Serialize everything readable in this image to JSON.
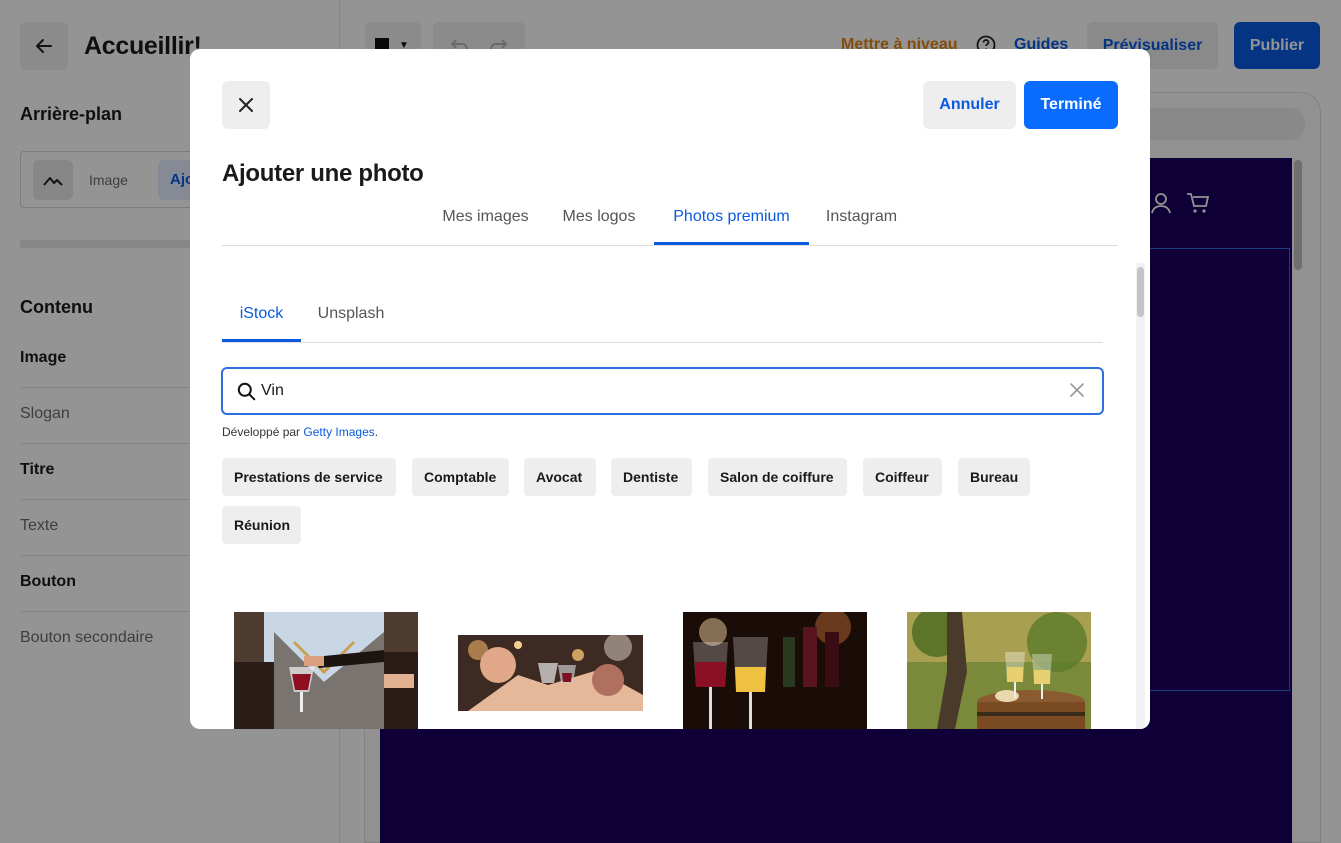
{
  "editor": {
    "page_title": "Accueillir!",
    "background_section": "Arrière-plan",
    "background_image_label": "Image",
    "background_add_label": "Ajouter",
    "content_section": "Contenu",
    "content_items": [
      "Image",
      "Slogan",
      "Titre",
      "Texte",
      "Bouton",
      "Bouton secondaire"
    ],
    "upgrade": "Mettre à niveau",
    "guides": "Guides",
    "preview": "Prévisualiser",
    "publish": "Publier",
    "site_color": "#1a0060",
    "accent_color": "#0a5be0",
    "upgrade_color": "#e0851a"
  },
  "modal": {
    "title": "Ajouter une photo",
    "cancel": "Annuler",
    "done": "Terminé",
    "tabs": [
      "Mes images",
      "Mes logos",
      "Photos premium",
      "Instagram"
    ],
    "active_tab": "Photos premium",
    "sub_tabs": [
      "iStock",
      "Unsplash"
    ],
    "active_sub_tab": "iStock",
    "search": {
      "value": "Vin",
      "placeholder": ""
    },
    "powered_prefix": "Développé par ",
    "powered_link": "Getty Images",
    "powered_suffix": ".",
    "chips": [
      "Prestations de service",
      "Comptable",
      "Avocat",
      "Dentiste",
      "Salon de coiffure",
      "Coiffeur",
      "Bureau",
      "Réunion"
    ],
    "photos": [
      {
        "name": "sommelier-pouring-red-wine"
      },
      {
        "name": "friends-toasting-wine-glasses"
      },
      {
        "name": "red-and-white-wine-glasses"
      },
      {
        "name": "wine-glasses-on-barrel-vineyard"
      }
    ]
  }
}
